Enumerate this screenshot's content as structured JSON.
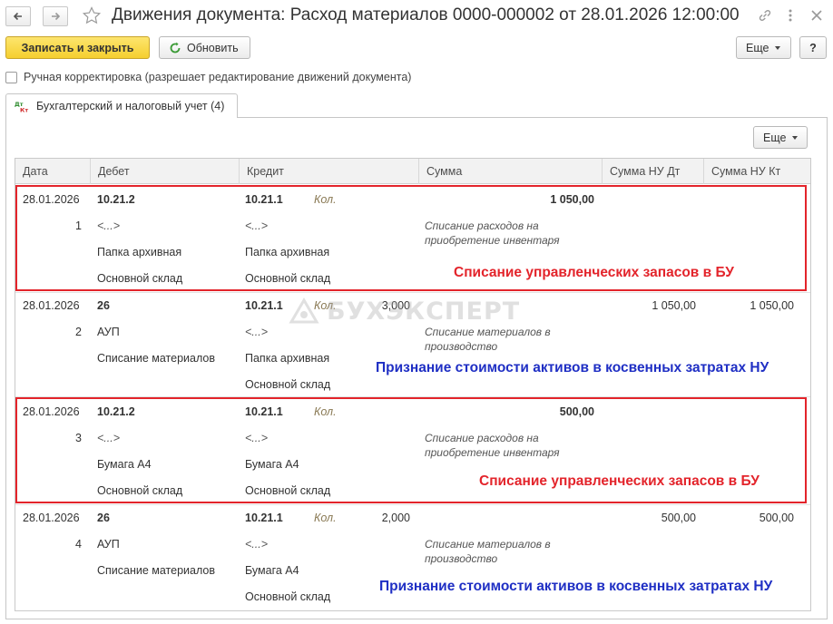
{
  "header": {
    "title": "Движения документа: Расход материалов 0000-000002 от 28.01.2026 12:00:00"
  },
  "toolbar": {
    "save_close_label": "Записать и закрыть",
    "refresh_label": "Обновить",
    "more_label": "Еще",
    "help_label": "?"
  },
  "manual_correction": {
    "label": "Ручная корректировка (разрешает редактирование движений документа)",
    "checked": false
  },
  "tabs": [
    {
      "label": "Бухгалтерский и налоговый учет (4)",
      "icon": "dt-kt-icon"
    }
  ],
  "table": {
    "more_label": "Еще",
    "columns": [
      "Дата",
      "Дебет",
      "Кредит",
      "Сумма",
      "Сумма НУ Дт",
      "Сумма НУ Кт"
    ],
    "rows": [
      {
        "date": "28.01.2026",
        "num": "1",
        "debit": [
          "10.21.2",
          "<...>",
          "Папка архивная",
          "Основной склад"
        ],
        "credit": [
          "10.21.1",
          "<...>",
          "Папка архивная",
          "Основной склад"
        ],
        "kol_label": "Кол.",
        "qty": "",
        "sum": "1 050,00",
        "desc": "Списание расходов на приобретение инвентаря",
        "nu_dt": "",
        "nu_kt": ""
      },
      {
        "date": "28.01.2026",
        "num": "2",
        "debit": [
          "26",
          "АУП",
          "Списание материалов",
          ""
        ],
        "credit": [
          "10.21.1",
          "<...>",
          "Папка архивная",
          "Основной склад"
        ],
        "kol_label": "Кол.",
        "qty": "3,000",
        "sum": "",
        "desc": "Списание материалов в производство",
        "nu_dt": "1 050,00",
        "nu_kt": "1 050,00"
      },
      {
        "date": "28.01.2026",
        "num": "3",
        "debit": [
          "10.21.2",
          "<...>",
          "Бумага А4",
          "Основной склад"
        ],
        "credit": [
          "10.21.1",
          "<...>",
          "Бумага А4",
          "Основной склад"
        ],
        "kol_label": "Кол.",
        "qty": "",
        "sum": "500,00",
        "desc": "Списание расходов на приобретение инвентаря",
        "nu_dt": "",
        "nu_kt": ""
      },
      {
        "date": "28.01.2026",
        "num": "4",
        "debit": [
          "26",
          "АУП",
          "Списание материалов",
          ""
        ],
        "credit": [
          "10.21.1",
          "<...>",
          "Бумага А4",
          "Основной склад"
        ],
        "kol_label": "Кол.",
        "qty": "2,000",
        "sum": "",
        "desc": "Списание материалов в производство",
        "nu_dt": "500,00",
        "nu_kt": "500,00"
      }
    ]
  },
  "annotations": [
    "Списание управленческих запасов в БУ",
    "Признание стоимости активов в косвенных затратах НУ",
    "Списание управленческих запасов в БУ",
    "Признание стоимости активов в косвенных затратах НУ"
  ],
  "watermark": "БУХЭКСПЕРТ",
  "colors": {
    "primary_button": "#f5cf2f",
    "annotation_red": "#e3242b",
    "annotation_blue": "#1f2fc4",
    "header_bg": "#f2f2f2"
  }
}
